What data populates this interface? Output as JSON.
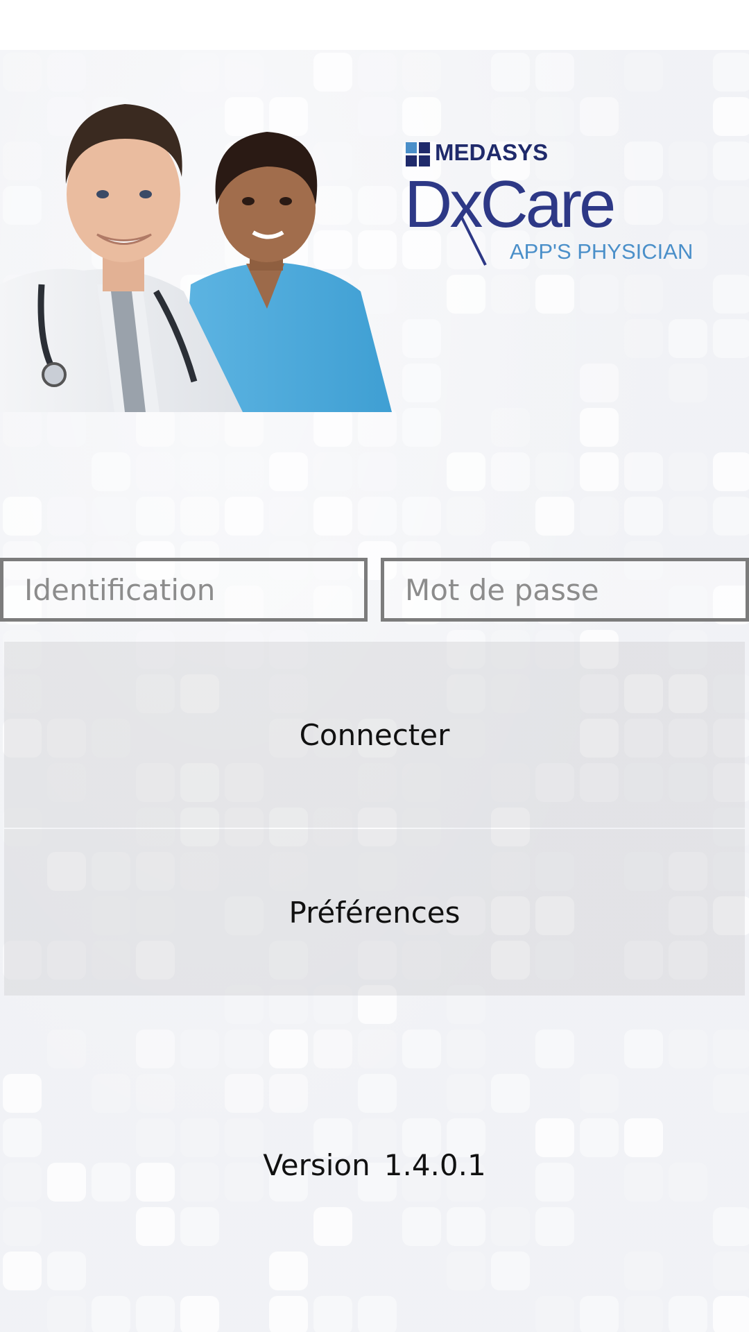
{
  "brand": {
    "company": "MEDASYS",
    "product": "DxCare",
    "subtitle": "APP'S PHYSICIAN",
    "colors": {
      "navy": "#2d3886",
      "light_blue": "#4a8fc9"
    }
  },
  "login": {
    "identification_placeholder": "Identification",
    "password_placeholder": "Mot de passe",
    "connect_label": "Connecter",
    "preferences_label": "Préférences"
  },
  "footer": {
    "version_label": "Version",
    "version_number": "1.4.0.1"
  }
}
